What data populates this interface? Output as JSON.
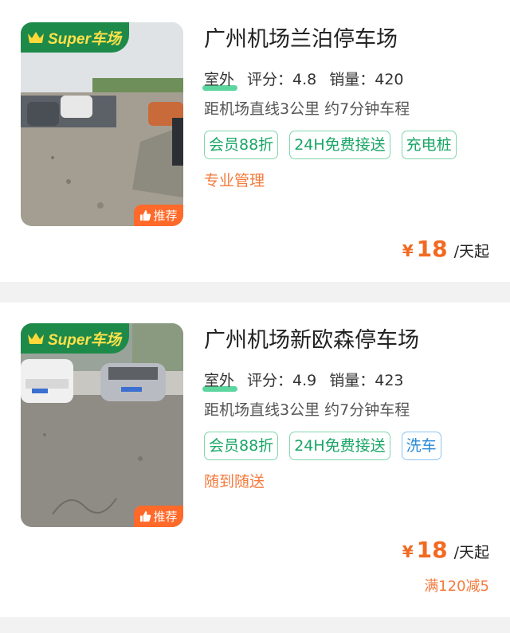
{
  "listings": [
    {
      "badge": "Super车场",
      "recommend": "推荐",
      "title": "广州机场兰泊停车场",
      "type": "室外",
      "rating": "评分：4.8",
      "sales": "销量：420",
      "distance": "距机场直线3公里 约7分钟车程",
      "tags": [
        "会员88折",
        "24H免费接送",
        "充电桩"
      ],
      "note": "专业管理",
      "price_symbol": "¥",
      "price": "18",
      "price_unit": "/天起"
    },
    {
      "badge": "Super车场",
      "recommend": "推荐",
      "title": "广州机场新欧森停车场",
      "type": "室外",
      "rating": "评分：4.9",
      "sales": "销量：423",
      "distance": "距机场直线3公里 约7分钟车程",
      "tags": [
        "会员88折",
        "24H免费接送",
        "洗车"
      ],
      "note": "随到随送",
      "price_symbol": "¥",
      "price": "18",
      "price_unit": "/天起",
      "discount": "满120减5"
    }
  ],
  "colors": {
    "brand_green": "#1d8a4a",
    "tag_green": "#19a566",
    "tag_blue": "#2b8ad8",
    "price_orange": "#f26a22",
    "recommend_orange": "#ff6a2a"
  },
  "icons": [
    "crown-icon",
    "thumbs-up-icon"
  ]
}
